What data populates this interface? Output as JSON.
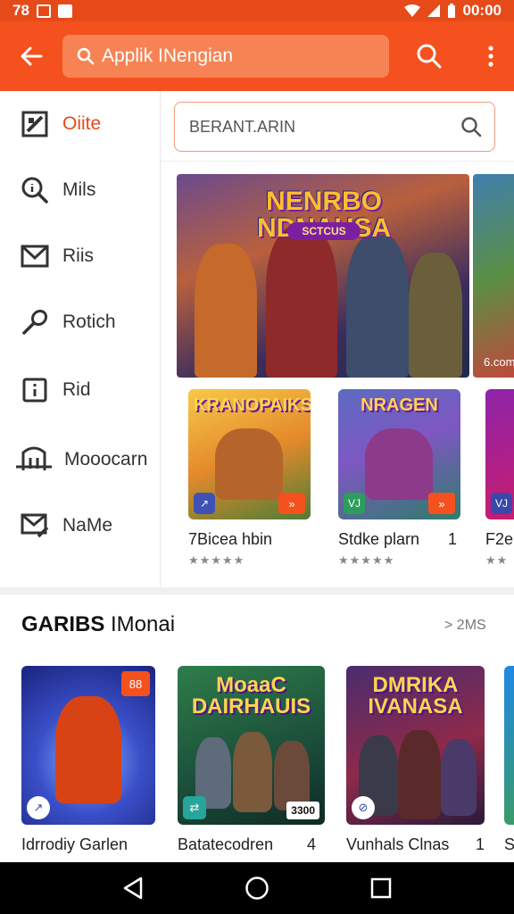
{
  "status_bar": {
    "left_text": "78",
    "time": "00:00"
  },
  "app_bar": {
    "back_icon": "arrow-left-icon",
    "search_pill": {
      "icon": "search-icon",
      "text": "Applik INengian"
    },
    "search_icon": "search-icon",
    "more_icon": "more-vertical-icon"
  },
  "sidebar": {
    "items": [
      {
        "label": "Oiite",
        "icon": "edit-square-icon",
        "active": true
      },
      {
        "label": "Mils",
        "icon": "search-info-icon",
        "active": false
      },
      {
        "label": "Riis",
        "icon": "mail-icon",
        "active": false
      },
      {
        "label": "Rotich",
        "icon": "microphone-icon",
        "active": false
      },
      {
        "label": "Rid",
        "icon": "info-box-icon",
        "active": false
      },
      {
        "label": "Mooocarn",
        "icon": "door-icon",
        "active": false
      },
      {
        "label": "NaMe",
        "icon": "mail-edit-icon",
        "active": false
      }
    ]
  },
  "search_box": {
    "placeholder": "BERANT.ARIN"
  },
  "banners": {
    "main": {
      "title": "NENRBO NDNAUSA",
      "subtitle": "SCTCUS"
    },
    "side": {
      "text": "6.com"
    }
  },
  "cards": [
    {
      "thumb_title": "KRANOPAIKS",
      "name": "7Bicea hbin",
      "number": "",
      "stars": "★★★★★",
      "badge_left": "↗",
      "badge_right": "»"
    },
    {
      "thumb_title": "NRAGEN",
      "name": "Stdke plarn",
      "number": "1",
      "stars": "★★★★★",
      "badge_left": "VJ",
      "badge_right": "»"
    },
    {
      "thumb_title": "",
      "name": "F2ei",
      "number": "",
      "stars": "★★",
      "badge_left": "VJ",
      "badge_right": ""
    }
  ],
  "section": {
    "title_bold": "GARIBS",
    "title_rest": " IMonai",
    "more": "> 2MS"
  },
  "game_cards": [
    {
      "thumb_title": "",
      "name": "Idrrodiy Garlen",
      "number": "",
      "badge_top": "88",
      "badge_count": "",
      "badge_left": "↗"
    },
    {
      "thumb_title": "MoaaC DAIRHAUIS",
      "name": "Batatecodren",
      "number": "4",
      "badge_top": "",
      "badge_count": "3300",
      "badge_left": "⇄"
    },
    {
      "thumb_title": "DMRIKA IVANASA",
      "name": "Vunhals Clnas",
      "number": "1",
      "badge_top": "",
      "badge_count": "",
      "badge_left": "⊘"
    },
    {
      "thumb_title": "",
      "name": "S",
      "number": "",
      "badge_top": "",
      "badge_count": "",
      "badge_left": ""
    }
  ],
  "nav_bar": {
    "back": "triangle-back-icon",
    "home": "circle-home-icon",
    "recents": "square-recents-icon"
  }
}
